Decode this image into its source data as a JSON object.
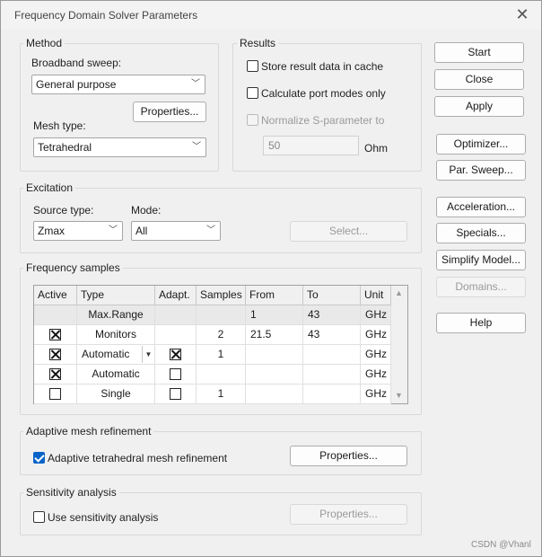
{
  "dialog": {
    "title": "Frequency Domain Solver Parameters",
    "close_glyph": "✕"
  },
  "method": {
    "label": "Method",
    "broadband_label": "Broadband sweep:",
    "broadband_value": "General purpose",
    "properties_label": "Properties...",
    "mesh_label": "Mesh type:",
    "mesh_value": "Tetrahedral"
  },
  "results": {
    "label": "Results",
    "store_cache": "Store result data in cache",
    "port_modes": "Calculate port modes only",
    "normalize": "Normalize S-parameter to",
    "impedance_value": "50",
    "impedance_unit": "Ohm"
  },
  "excitation": {
    "label": "Excitation",
    "source_label": "Source type:",
    "source_value": "Zmax",
    "mode_label": "Mode:",
    "mode_value": "All",
    "select_label": "Select..."
  },
  "freq": {
    "label": "Frequency samples",
    "headers": [
      "Active",
      "Type",
      "Adapt.",
      "Samples",
      "From",
      "To",
      "Unit"
    ],
    "rows": [
      {
        "active": null,
        "type": "Max.Range",
        "adapt": null,
        "samples": "",
        "from": "1",
        "to": "43",
        "unit": "GHz"
      },
      {
        "active": true,
        "type": "Monitors",
        "adapt": null,
        "samples": "2",
        "from": "21.5",
        "to": "43",
        "unit": "GHz"
      },
      {
        "active": true,
        "type": "Automatic",
        "adapt": true,
        "samples": "1",
        "from": "",
        "to": "",
        "unit": "GHz"
      },
      {
        "active": true,
        "type": "Automatic",
        "adapt": false,
        "samples": "",
        "from": "",
        "to": "",
        "unit": "GHz"
      },
      {
        "active": false,
        "type": "Single",
        "adapt": false,
        "samples": "1",
        "from": "",
        "to": "",
        "unit": "GHz"
      }
    ]
  },
  "adaptive": {
    "label": "Adaptive mesh refinement",
    "checkbox": "Adaptive tetrahedral mesh refinement",
    "checked": true,
    "properties_label": "Properties..."
  },
  "sensitivity": {
    "label": "Sensitivity analysis",
    "checkbox": "Use sensitivity analysis",
    "properties_label": "Properties..."
  },
  "side_buttons": {
    "start": "Start",
    "close": "Close",
    "apply": "Apply",
    "optimizer": "Optimizer...",
    "par_sweep": "Par. Sweep...",
    "acceleration": "Acceleration...",
    "specials": "Specials...",
    "simplify": "Simplify Model...",
    "domains": "Domains...",
    "help": "Help"
  },
  "watermark": "CSDN @Vhanl",
  "colors": {
    "accent": "#0a64c8",
    "dialog_bg": "#f0f0f0",
    "disabled_text": "#9a9a9a"
  }
}
